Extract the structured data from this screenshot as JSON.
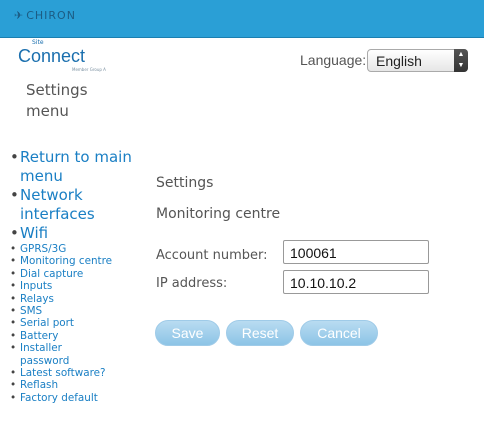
{
  "header": {
    "brand": "CHIRON"
  },
  "logo": {
    "site": "Site",
    "word": "Connect",
    "tag": "Member Group A"
  },
  "language": {
    "label": "Language:",
    "selected": "English"
  },
  "sidebar": {
    "title_line1": "Settings",
    "title_line2": "menu",
    "big_items": [
      "Return to main menu",
      "Network interfaces",
      "Wifi"
    ],
    "small_items": [
      "GPRS/3G",
      "Monitoring centre",
      "Dial capture",
      "Inputs",
      "Relays",
      "SMS",
      "Serial port",
      "Battery",
      "Installer password",
      "Latest software?",
      "Reflash",
      "Factory default"
    ]
  },
  "main": {
    "title": "Settings",
    "section": "Monitoring centre",
    "fields": [
      {
        "label": "Account number:",
        "value": "100061"
      },
      {
        "label": "IP address:",
        "value": "10.10.10.2"
      }
    ],
    "buttons": {
      "save": "Save",
      "reset": "Reset",
      "cancel": "Cancel"
    }
  }
}
